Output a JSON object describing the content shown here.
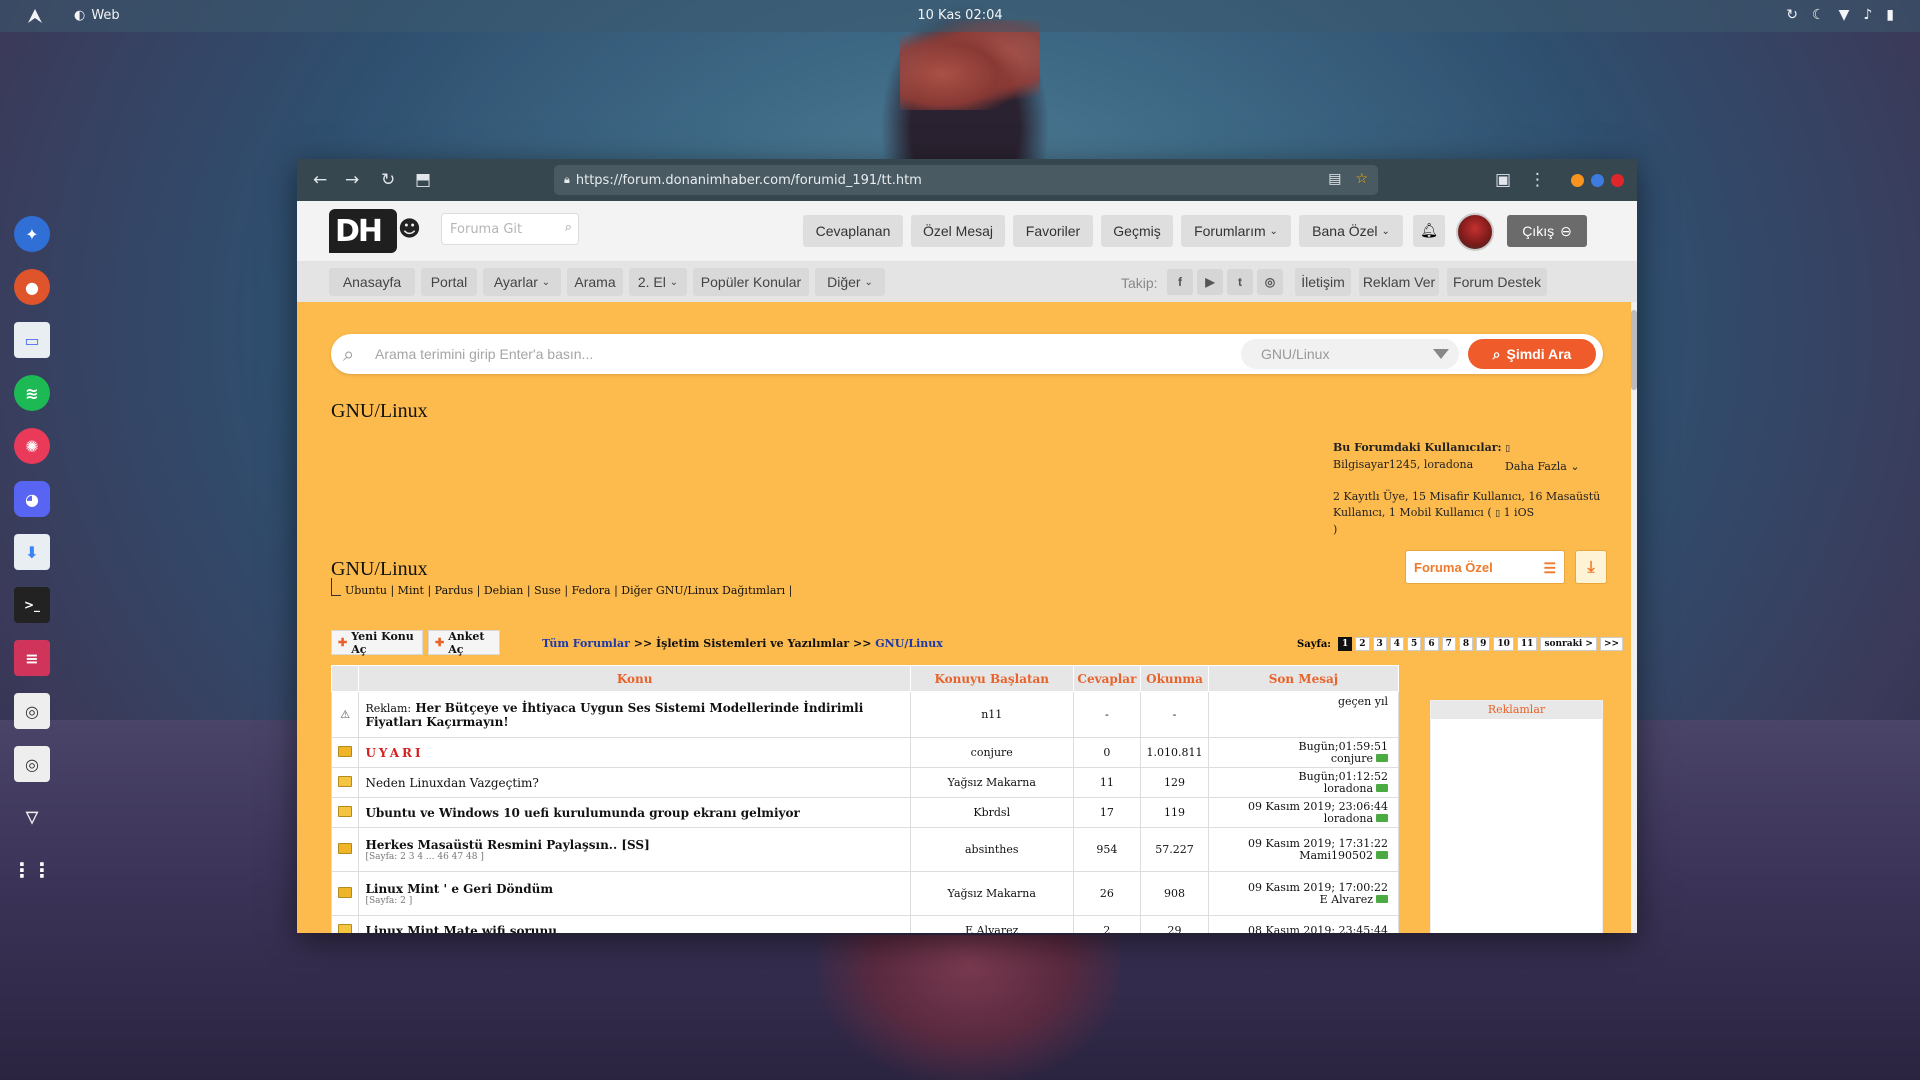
{
  "os": {
    "app_name": "Web",
    "clock": "10 Kas  02:04"
  },
  "browser": {
    "url": "https://forum.donanimhaber.com/forumid_191/tt.htm"
  },
  "header": {
    "logo_text": "DH",
    "search_placeholder": "Foruma Git",
    "nav": [
      "Cevaplanan",
      "Özel Mesaj",
      "Favoriler",
      "Geçmiş",
      "Forumlarım",
      "Bana Özel"
    ],
    "logout": "Çıkış"
  },
  "subnav": {
    "items": [
      "Anasayfa",
      "Portal",
      "Ayarlar",
      "Arama",
      "2. El",
      "Popüler Konular",
      "Diğer"
    ],
    "follow_label": "Takip:",
    "right_items": [
      "İletişim",
      "Reklam Ver",
      "Forum Destek"
    ]
  },
  "search": {
    "placeholder": "Arama terimini girip Enter'a basın...",
    "scope": "GNU/Linux",
    "button": "Şimdi Ara"
  },
  "page": {
    "title_top": "GNU/Linux",
    "title_main": "GNU/Linux",
    "users_heading": "Bu Forumdaki Kullanıcılar:",
    "users_list": "Bilgisayar1245, loradona",
    "more": "Daha Fazla",
    "stats": "2 Kayıtlı Üye, 15 Misafir Kullanıcı, 16 Masaüstü Kullanıcı, 1 Mobil Kullanıcı (",
    "stats_ios": "1 iOS",
    "stats_end": ")",
    "forum_special": "Foruma Özel",
    "subforums": "Ubuntu | Mint | Pardus | Debian | Suse | Fedora | Diğer GNU/Linux Dağıtımları |",
    "new_topic": "Yeni Konu Aç",
    "new_poll": "Anket Aç",
    "crumb_all": "Tüm Forumlar",
    "crumb_sep": ">>",
    "crumb_mid": "İşletim Sistemleri ve Yazılımlar",
    "crumb_cur": "GNU/Linux",
    "pager_label": "Sayfa:",
    "pages": [
      "1",
      "2",
      "3",
      "4",
      "5",
      "6",
      "7",
      "8",
      "9",
      "10",
      "11",
      "sonraki >",
      ">>"
    ],
    "ads_title": "Reklamlar"
  },
  "table": {
    "headers": [
      "Konu",
      "Konuyu Başlatan",
      "Cevaplar",
      "Okunma",
      "Son Mesaj"
    ],
    "rows": [
      {
        "prefix": "Reklam:",
        "title": "Her Bütçeye ve İhtiyaca Uygun Ses Sistemi Modellerinde İndirimli Fiyatları Kaçırmayın!",
        "pages": "",
        "author": "n11",
        "replies": "-",
        "views": "-",
        "last_time": "geçen yıl",
        "last_user": ""
      },
      {
        "prefix": "",
        "title": "UYARI",
        "pages": "",
        "author": "conjure",
        "replies": "0",
        "views": "1.010.811",
        "last_time": "Bugün;01:59:51",
        "last_user": "conjure"
      },
      {
        "prefix": "",
        "title": "Neden Linuxdan Vazgeçtim?",
        "pages": "",
        "author": "Yağsız Makarna",
        "replies": "11",
        "views": "129",
        "last_time": "Bugün;01:12:52",
        "last_user": "loradona"
      },
      {
        "prefix": "",
        "title": "Ubuntu ve Windows 10 uefi kurulumunda group ekranı gelmiyor",
        "pages": "",
        "author": "Kbrdsl",
        "replies": "17",
        "views": "119",
        "last_time": "09 Kasım 2019; 23:06:44",
        "last_user": "loradona"
      },
      {
        "prefix": "",
        "title": "Herkes Masaüstü Resmini Paylaşsın.. [SS]",
        "pages": "[Sayfa: 2 3 4 ... 46 47 48 ]",
        "author": "absinthes",
        "replies": "954",
        "views": "57.227",
        "last_time": "09 Kasım 2019; 17:31:22",
        "last_user": "Mami190502"
      },
      {
        "prefix": "",
        "title": "Linux Mint ' e Geri Döndüm",
        "pages": "[Sayfa: 2 ]",
        "author": "Yağsız Makarna",
        "replies": "26",
        "views": "908",
        "last_time": "09 Kasım 2019; 17:00:22",
        "last_user": "E Alvarez"
      },
      {
        "prefix": "",
        "title": "Linux Mint Mate wifi sorunu",
        "pages": "",
        "author": "E Alvarez",
        "replies": "2",
        "views": "29",
        "last_time": "08 Kasım 2019; 23:45:44",
        "last_user": ""
      }
    ]
  }
}
